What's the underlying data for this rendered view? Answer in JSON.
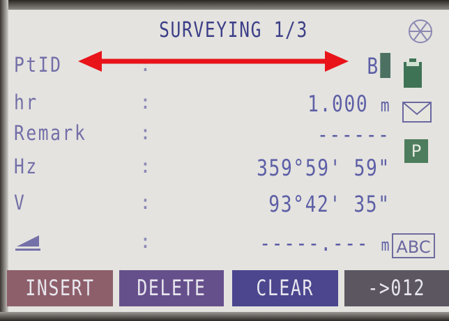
{
  "header": {
    "title": "SURVEYING 1/3"
  },
  "rows": [
    {
      "label": "PtID",
      "separator": ":",
      "value": "B",
      "unit": ""
    },
    {
      "label": "hr",
      "separator": ":",
      "value": "1.000",
      "unit": "m"
    },
    {
      "label": "Remark",
      "separator": ":",
      "value": "------",
      "unit": ""
    },
    {
      "label": "Hz",
      "separator": ":",
      "value": "359°59' 59\"",
      "unit": ""
    },
    {
      "label": "V",
      "separator": ":",
      "value": "93°42' 35\"",
      "unit": ""
    },
    {
      "label": "",
      "separator": ":",
      "value": "-----.---",
      "unit": "m"
    }
  ],
  "status": {
    "input_mode": "ABC",
    "p_indicator": "P",
    "battery_level": 0.8
  },
  "softkeys": [
    {
      "label": "INSERT"
    },
    {
      "label": "DELETE"
    },
    {
      "label": "CLEAR"
    },
    {
      "label": "->012"
    }
  ],
  "annotation": {
    "color": "#e8141a"
  },
  "colors": {
    "text": "#5d5fa6",
    "label": "#736fa8",
    "softkey_insert": "#8d5f6a",
    "softkey_delete": "#66508c",
    "softkey_clear": "#4b468e",
    "softkey_012": "#5b5660"
  },
  "icons": [
    "target-icon",
    "battery-icon",
    "envelope-icon",
    "p-indicator",
    "slope-distance-icon"
  ]
}
